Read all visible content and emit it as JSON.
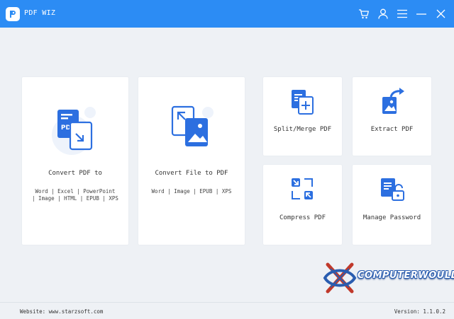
{
  "app": {
    "title": "PDF WIZ",
    "accent": "#2c8cf4"
  },
  "titlebar": {
    "icons": [
      "cart-icon",
      "user-icon",
      "menu-icon",
      "minimize-icon",
      "close-icon"
    ]
  },
  "cards": {
    "convert_pdf": {
      "label": "Convert PDF to",
      "formats_line1": "Word | Excel | PowerPoint",
      "formats_line2": "| Image | HTML | EPUB | XPS",
      "icon": "pdf-convert-icon"
    },
    "convert_file": {
      "label": "Convert File to PDF",
      "formats_line1": "Word | Image | EPUB | XPS",
      "icon": "file-to-pdf-icon"
    },
    "split_merge": {
      "label": "Split/Merge PDF",
      "icon": "split-merge-icon"
    },
    "extract": {
      "label": "Extract PDF",
      "icon": "extract-icon"
    },
    "compress": {
      "label": "Compress PDF",
      "icon": "compress-icon"
    },
    "manage_password": {
      "label": "Manage Password",
      "icon": "password-icon"
    }
  },
  "footer": {
    "website": "Website: www.starzsoft.com",
    "version": "Version: 1.1.0.2"
  },
  "watermark": {
    "text": "COMPUTERWOULD"
  }
}
